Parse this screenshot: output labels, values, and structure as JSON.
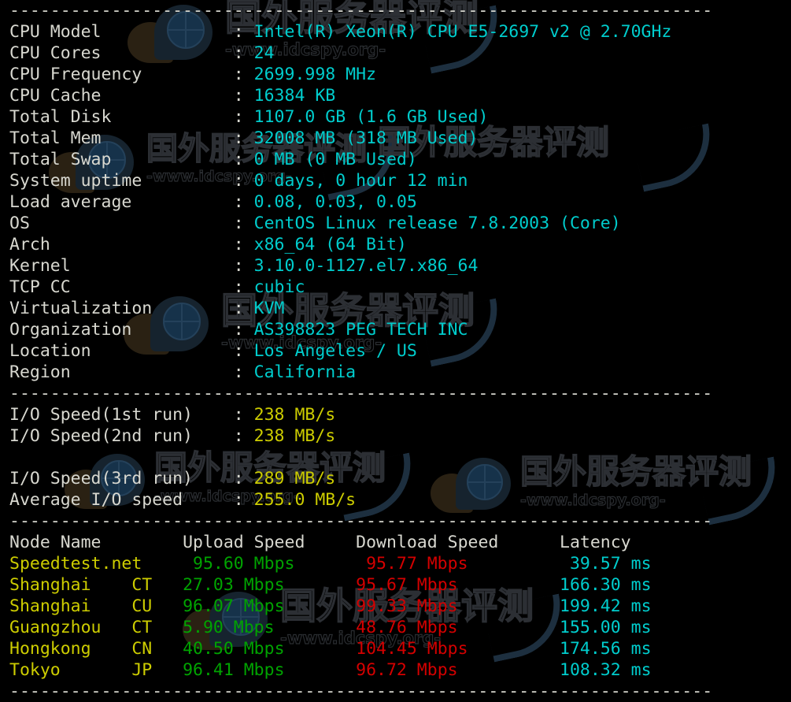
{
  "terminal": {
    "colors": {
      "background": "#000000",
      "label": "#d8d8d0",
      "cyan": "#00cdcd",
      "yellow": "#cdcd00",
      "green": "#00a300",
      "red": "#d40000"
    },
    "separator": "----------------------------------------------------------------------",
    "separator_char": "-"
  },
  "watermark": {
    "text_cn": "国外服务器评测",
    "text_url": "-www.idcspy.org-"
  },
  "system_info": {
    "separator_label": "system-info-separator",
    "rows": [
      {
        "label": "CPU Model",
        "sep": ":",
        "value": "Intel(R) Xeon(R) CPU E5-2697 v2 @ 2.70GHz"
      },
      {
        "label": "CPU Cores",
        "sep": ":",
        "value": "24"
      },
      {
        "label": "CPU Frequency",
        "sep": ":",
        "value": "2699.998 MHz"
      },
      {
        "label": "CPU Cache",
        "sep": ":",
        "value": "16384 KB"
      },
      {
        "label": "Total Disk",
        "sep": ":",
        "value": "1107.0 GB (1.6 GB Used)"
      },
      {
        "label": "Total Mem",
        "sep": ":",
        "value": "32008 MB (318 MB Used)"
      },
      {
        "label": "Total Swap",
        "sep": ":",
        "value": "0 MB (0 MB Used)"
      },
      {
        "label": "System uptime",
        "sep": ":",
        "value": "0 days, 0 hour 12 min"
      },
      {
        "label": "Load average",
        "sep": ":",
        "value": "0.08, 0.03, 0.05"
      },
      {
        "label": "OS",
        "sep": ":",
        "value": "CentOS Linux release 7.8.2003 (Core)"
      },
      {
        "label": "Arch",
        "sep": ":",
        "value": "x86_64 (64 Bit)"
      },
      {
        "label": "Kernel",
        "sep": ":",
        "value": "3.10.0-1127.el7.x86_64"
      },
      {
        "label": "TCP CC",
        "sep": ":",
        "value": "cubic"
      },
      {
        "label": "Virtualization",
        "sep": ":",
        "value": "KVM"
      },
      {
        "label": "Organization",
        "sep": ":",
        "value": "AS398823 PEG TECH INC"
      },
      {
        "label": "Location",
        "sep": ":",
        "value": "Los Angeles / US"
      },
      {
        "label": "Region",
        "sep": ":",
        "value": "California"
      }
    ]
  },
  "io_speed": {
    "rows": [
      {
        "label": "I/O Speed(1st run)",
        "sep": ":",
        "value": "238 MB/s"
      },
      {
        "label": "I/O Speed(2nd run)",
        "sep": ":",
        "value": "238 MB/s"
      },
      {
        "label": "I/O Speed(3rd run)",
        "sep": ":",
        "value": "289 MB/s"
      },
      {
        "label": "Average I/O speed",
        "sep": ":",
        "value": "255.0 MB/s"
      }
    ]
  },
  "speedtest": {
    "headers": {
      "node": "Node Name",
      "upload": "Upload Speed",
      "download": "Download Speed",
      "latency": "Latency"
    },
    "rows": [
      {
        "node": "Speedtest.net",
        "isp": "",
        "upload": "95.60 Mbps",
        "download": "95.77 Mbps",
        "latency": "39.57 ms"
      },
      {
        "node": "Shanghai",
        "isp": "CT",
        "upload": "27.03 Mbps",
        "download": "95.67 Mbps",
        "latency": "166.30 ms"
      },
      {
        "node": "Shanghai",
        "isp": "CU",
        "upload": "96.07 Mbps",
        "download": "99.33 Mbps",
        "latency": "199.42 ms"
      },
      {
        "node": "Guangzhou",
        "isp": "CT",
        "upload": "5.90 Mbps",
        "download": "48.76 Mbps",
        "latency": "155.00 ms"
      },
      {
        "node": "Hongkong",
        "isp": "CN",
        "upload": "40.50 Mbps",
        "download": "104.45 Mbps",
        "latency": "174.56 ms"
      },
      {
        "node": "Tokyo",
        "isp": "JP",
        "upload": "96.41 Mbps",
        "download": "96.72 Mbps",
        "latency": "108.32 ms"
      }
    ]
  }
}
